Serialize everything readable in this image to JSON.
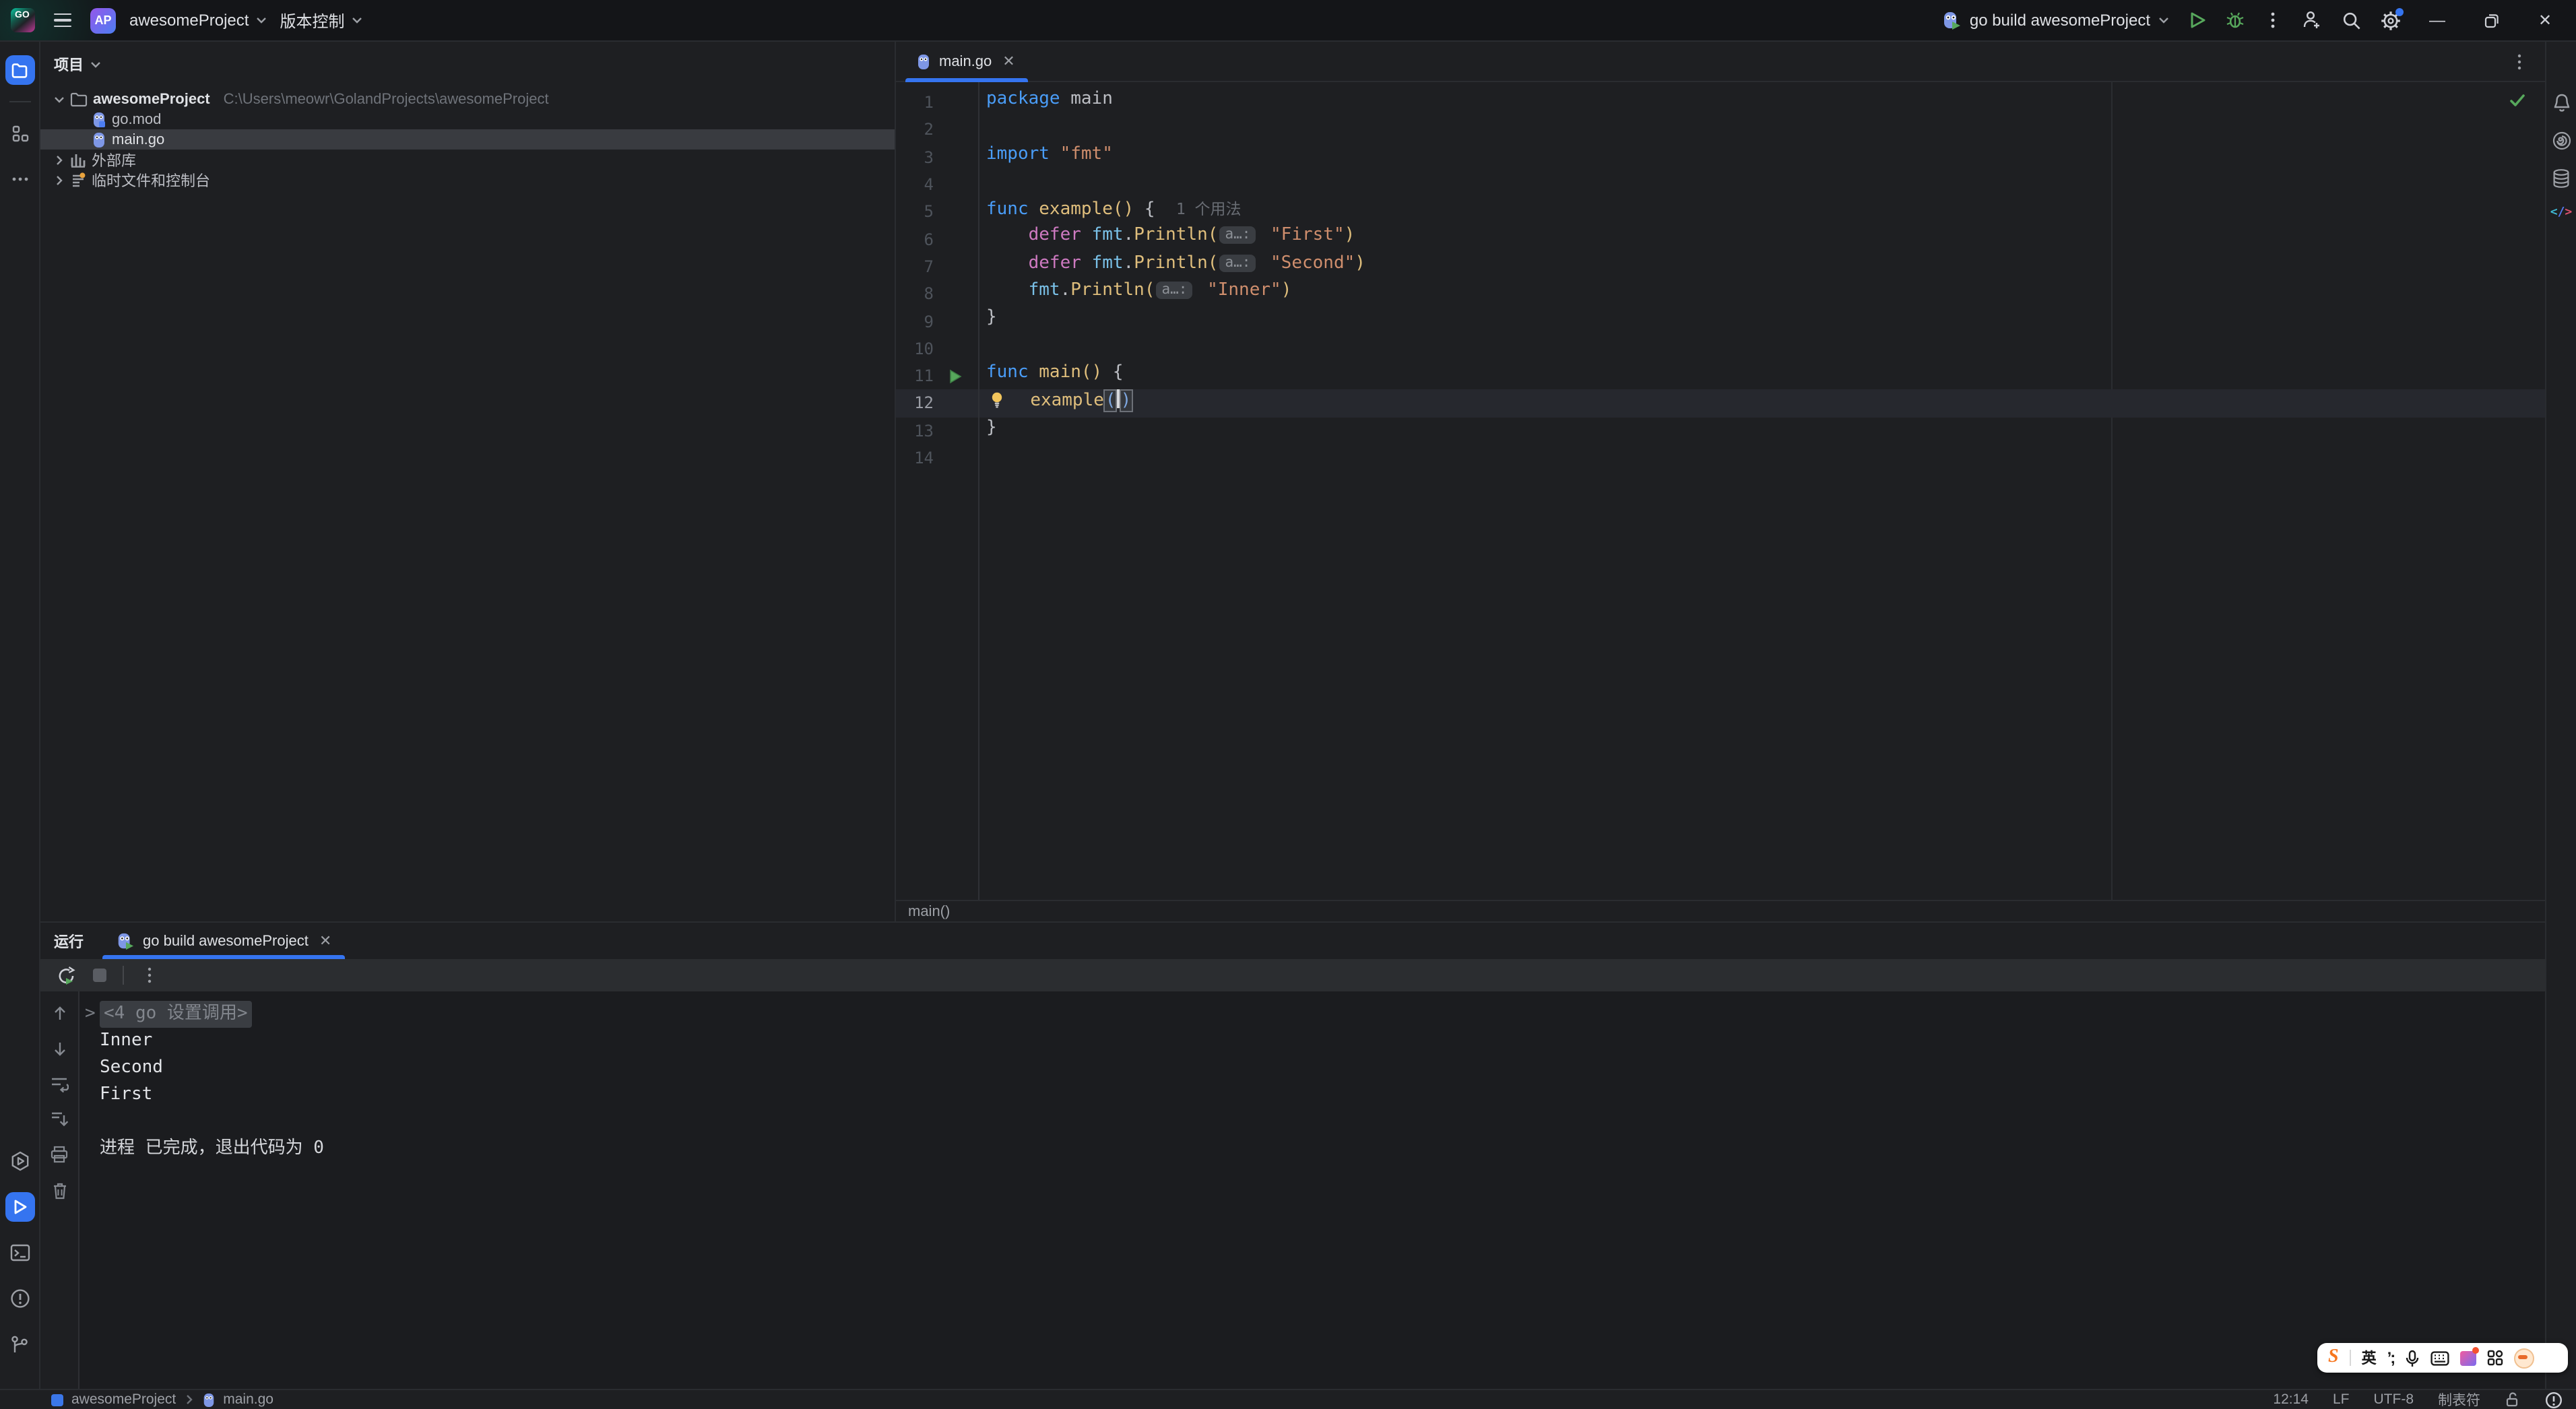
{
  "colors": {
    "accent": "#3574F0",
    "run_green": "#57A85C",
    "keyword_blue": "#4A9DF8",
    "defer_pink": "#CE7AC1",
    "func_yellow": "#DFBE7C",
    "string_orange": "#CF8E6D",
    "package_blue": "#7AC1E8",
    "editor_bg": "#1E1F22",
    "toolbar_bg": "#2B2D30"
  },
  "titlebar": {
    "logo_text": "GO",
    "project_badge": "AP",
    "project_name": "awesomeProject",
    "vcs_menu": "版本控制",
    "run_config": "go build awesomeProject"
  },
  "project_panel": {
    "title": "项目",
    "root_name": "awesomeProject",
    "root_path": "C:\\Users\\meowr\\GolandProjects\\awesomeProject",
    "file_gomod": "go.mod",
    "file_maingo": "main.go",
    "external_libs": "外部库",
    "scratches": "临时文件和控制台"
  },
  "editor": {
    "tab_title": "main.go",
    "breadcrumb": "main()",
    "current_line": 12,
    "run_gutter_line": 11,
    "total_lines": 14,
    "code_lines": [
      [
        {
          "t": "kw",
          "v": "package"
        },
        {
          "t": "pl",
          "v": " main"
        }
      ],
      [],
      [
        {
          "t": "kw",
          "v": "import"
        },
        {
          "t": "pl",
          "v": " "
        },
        {
          "t": "str",
          "v": "\"fmt\""
        }
      ],
      [],
      [
        {
          "t": "kw",
          "v": "func"
        },
        {
          "t": "pl",
          "v": " "
        },
        {
          "t": "fn",
          "v": "example()"
        },
        {
          "t": "pl",
          "v": " {  "
        },
        {
          "t": "hint",
          "v": "1 个用法"
        }
      ],
      [
        {
          "t": "pl",
          "v": "    "
        },
        {
          "t": "pk",
          "v": "defer"
        },
        {
          "t": "pl",
          "v": " "
        },
        {
          "t": "pkg",
          "v": "fmt"
        },
        {
          "t": "pl",
          "v": "."
        },
        {
          "t": "fn",
          "v": "Println("
        },
        {
          "t": "chip",
          "v": "a…:"
        },
        {
          "t": "pl",
          "v": " "
        },
        {
          "t": "str",
          "v": "\"First\""
        },
        {
          "t": "fn",
          "v": ")"
        }
      ],
      [
        {
          "t": "pl",
          "v": "    "
        },
        {
          "t": "pk",
          "v": "defer"
        },
        {
          "t": "pl",
          "v": " "
        },
        {
          "t": "pkg",
          "v": "fmt"
        },
        {
          "t": "pl",
          "v": "."
        },
        {
          "t": "fn",
          "v": "Println("
        },
        {
          "t": "chip",
          "v": "a…:"
        },
        {
          "t": "pl",
          "v": " "
        },
        {
          "t": "str",
          "v": "\"Second\""
        },
        {
          "t": "fn",
          "v": ")"
        }
      ],
      [
        {
          "t": "pl",
          "v": "    "
        },
        {
          "t": "pkg",
          "v": "fmt"
        },
        {
          "t": "pl",
          "v": "."
        },
        {
          "t": "fn",
          "v": "Println("
        },
        {
          "t": "chip",
          "v": "a…:"
        },
        {
          "t": "pl",
          "v": " "
        },
        {
          "t": "str",
          "v": "\"Inner\""
        },
        {
          "t": "fn",
          "v": ")"
        }
      ],
      [
        {
          "t": "pl",
          "v": "}"
        }
      ],
      [],
      [
        {
          "t": "kw",
          "v": "func"
        },
        {
          "t": "pl",
          "v": " "
        },
        {
          "t": "fn",
          "v": "main()"
        },
        {
          "t": "pl",
          "v": " {"
        }
      ],
      [
        {
          "t": "bulb"
        },
        {
          "t": "pl",
          "v": "  "
        },
        {
          "t": "fn",
          "v": "example"
        },
        {
          "t": "cp"
        }
      ],
      [
        {
          "t": "pl",
          "v": "}"
        }
      ],
      []
    ]
  },
  "run_panel": {
    "title": "运行",
    "tab_title": "go build awesomeProject",
    "console_lines": [
      {
        "t": "fold",
        "v": "<4 go 设置调用>"
      },
      {
        "t": "out",
        "v": "Inner"
      },
      {
        "t": "out",
        "v": "Second"
      },
      {
        "t": "out",
        "v": "First"
      },
      {
        "t": "blank",
        "v": ""
      },
      {
        "t": "sys",
        "v": "进程 已完成，退出代码为 0"
      }
    ]
  },
  "status_bar": {
    "project": "awesomeProject",
    "file": "main.go",
    "caret": "12:14",
    "line_ending": "LF",
    "encoding": "UTF-8",
    "indent": "制表符"
  },
  "ime_bar": {
    "brand": "S",
    "mode": "英",
    "punct": "’;"
  }
}
